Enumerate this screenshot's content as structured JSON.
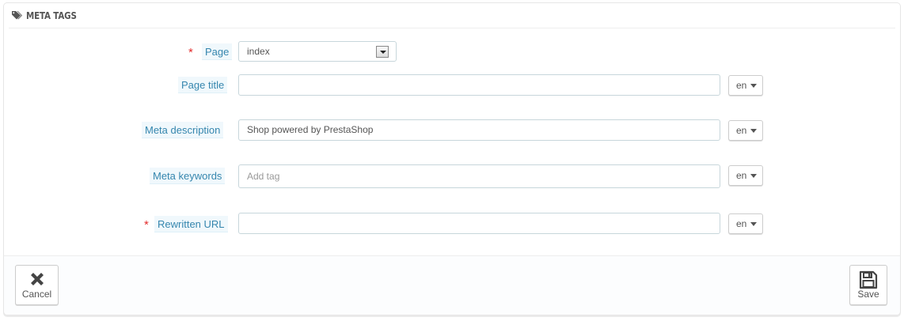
{
  "panel": {
    "title": "META TAGS",
    "title_icon": "tags-icon"
  },
  "form": {
    "page": {
      "label": "Page",
      "required_mark": "*",
      "value": "index"
    },
    "page_title": {
      "label": "Page title",
      "value": "",
      "lang": "en"
    },
    "meta_description": {
      "label": "Meta description",
      "value": "Shop powered by PrestaShop",
      "lang": "en"
    },
    "meta_keywords": {
      "label": "Meta keywords",
      "placeholder": "Add tag",
      "lang": "en"
    },
    "rewritten_url": {
      "label": "Rewritten URL",
      "required_mark": "*",
      "value": "",
      "lang": "en"
    }
  },
  "footer": {
    "cancel_label": "Cancel",
    "cancel_icon": "close-icon",
    "save_label": "Save",
    "save_icon": "floppy-disk-icon"
  },
  "colors": {
    "label_text": "#3586ae",
    "label_bg": "#f0f8fc",
    "required": "#e32d2d",
    "input_border": "#c7d6db"
  }
}
